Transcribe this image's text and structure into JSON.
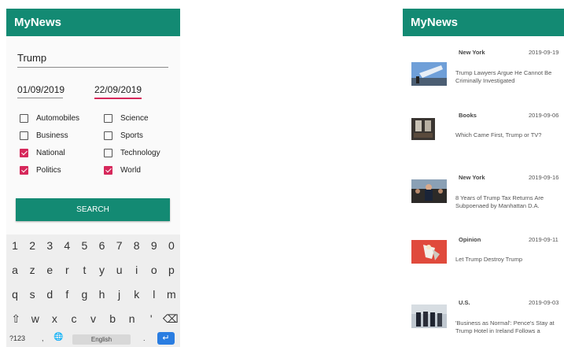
{
  "left_screen": {
    "app_title": "MyNews",
    "query": "Trump",
    "begin_date": "01/09/2019",
    "end_date": "22/09/2019",
    "categories": [
      {
        "label": "Automobiles",
        "checked": false
      },
      {
        "label": "Science",
        "checked": false
      },
      {
        "label": "Business",
        "checked": false
      },
      {
        "label": "Sports",
        "checked": false
      },
      {
        "label": "National",
        "checked": true
      },
      {
        "label": "Technology",
        "checked": false
      },
      {
        "label": "Politics",
        "checked": true
      },
      {
        "label": "World",
        "checked": true
      }
    ],
    "search_label": "SEARCH",
    "keyboard": {
      "row1": [
        "1",
        "2",
        "3",
        "4",
        "5",
        "6",
        "7",
        "8",
        "9",
        "0"
      ],
      "row2": [
        "a",
        "z",
        "e",
        "r",
        "t",
        "y",
        "u",
        "i",
        "o",
        "p"
      ],
      "row3": [
        "q",
        "s",
        "d",
        "f",
        "g",
        "h",
        "j",
        "k",
        "l",
        "m"
      ],
      "row4": [
        "⇧",
        "w",
        "x",
        "c",
        "v",
        "b",
        "n",
        "'",
        "⌫"
      ],
      "symbols": "?123",
      "comma": ",",
      "globe": "🌐",
      "space": "English",
      "period": ".",
      "enter": "↵"
    }
  },
  "right_screen": {
    "app_title": "MyNews",
    "articles": [
      {
        "section": "New York",
        "date": "2019-09-19",
        "headline": "Trump Lawyers Argue He Cannot Be Criminally Investigated",
        "thumb": "plane-thumbnail"
      },
      {
        "section": "Books",
        "date": "2019-09-06",
        "headline": "Which Came First, Trump or TV?",
        "thumb": "room-thumbnail"
      },
      {
        "section": "New York",
        "date": "2019-09-16",
        "headline": "8 Years of Trump Tax Returns Are Subpoenaed by Manhattan D.A.",
        "thumb": "crowd-thumbnail"
      },
      {
        "section": "Opinion",
        "date": "2019-09-11",
        "headline": "Let Trump Destroy Trump",
        "thumb": "illustration-thumbnail"
      },
      {
        "section": "U.S.",
        "date": "2019-09-03",
        "headline": "'Business as Normal': Pence's Stay at Trump Hotel in Ireland Follows a",
        "thumb": "group-thumbnail"
      }
    ]
  },
  "colors": {
    "primary": "#138a73",
    "accent": "#d6285b",
    "enter_key": "#2a7de1"
  }
}
